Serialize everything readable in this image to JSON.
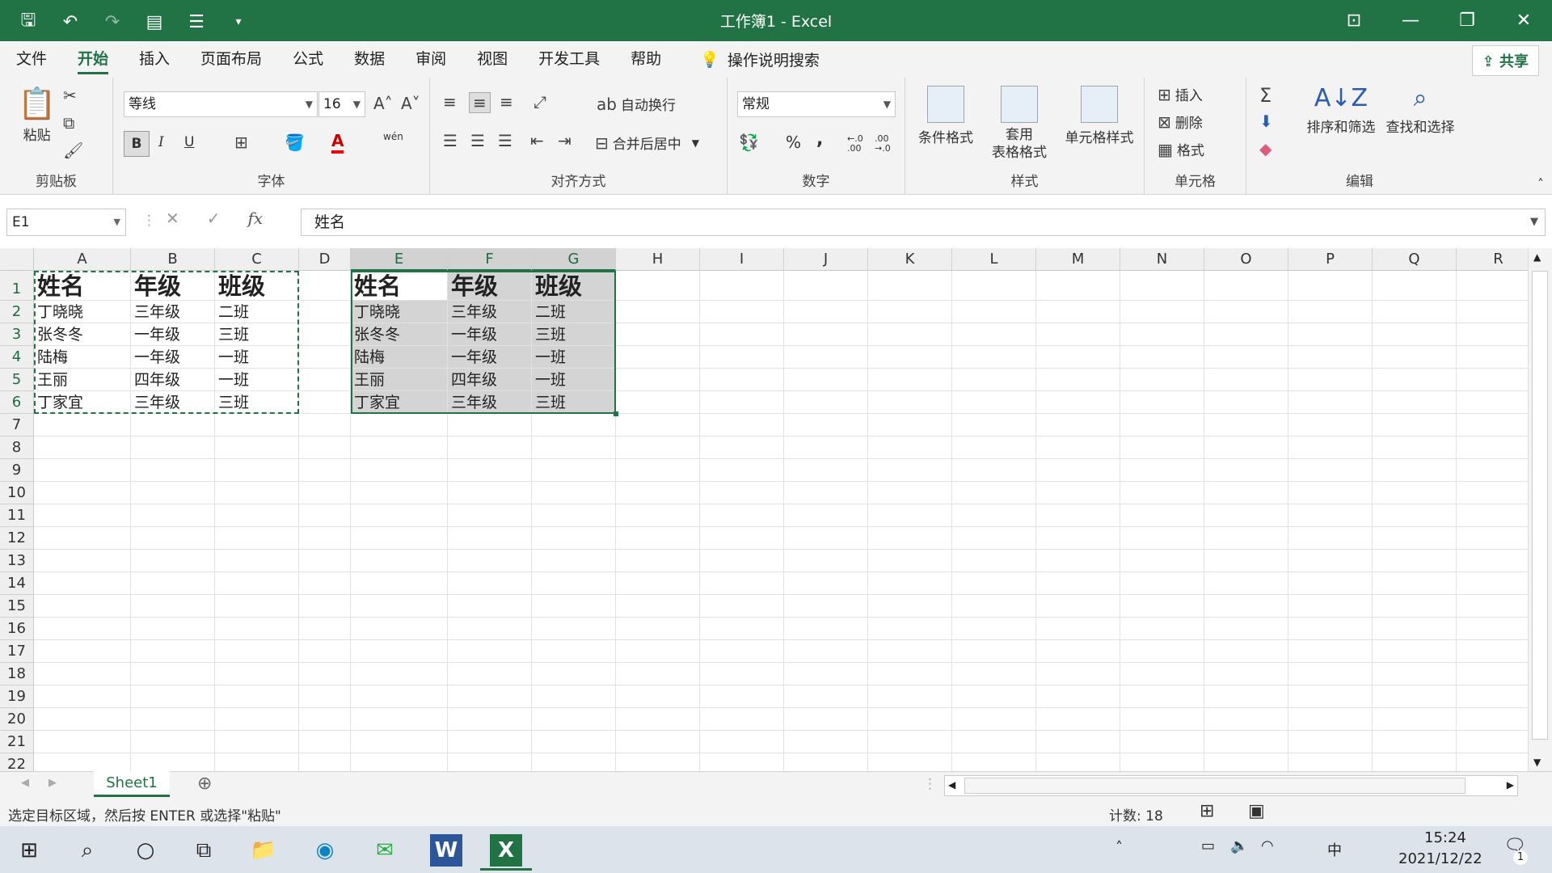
{
  "window": {
    "title": "工作簿1  -  Excel"
  },
  "menu": {
    "tabs": [
      "文件",
      "开始",
      "插入",
      "页面布局",
      "公式",
      "数据",
      "审阅",
      "视图",
      "开发工具",
      "帮助"
    ],
    "active": "开始",
    "search": "操作说明搜索",
    "share": "共享"
  },
  "ribbon": {
    "clipboard": {
      "label": "剪贴板",
      "paste": "粘贴"
    },
    "font": {
      "label": "字体",
      "name": "等线",
      "size": "16",
      "bold": "B",
      "italic": "I",
      "underline": "U",
      "phonetic": "wén"
    },
    "alignment": {
      "label": "对齐方式",
      "wrap": "自动换行",
      "merge": "合并后居中"
    },
    "number": {
      "label": "数字",
      "format": "常规",
      "percent": "%",
      "comma": ",",
      "inc_decimal": "←.0 .00",
      "dec_decimal": ".00 →.0"
    },
    "styles": {
      "label": "样式",
      "conditional": "条件格式",
      "table_format_line1": "套用",
      "table_format_line2": "表格格式",
      "cell_styles": "单元格样式"
    },
    "cells": {
      "label": "单元格",
      "insert": "插入",
      "delete": "删除",
      "format": "格式"
    },
    "editing": {
      "label": "编辑",
      "sort_filter": "排序和筛选",
      "find_select": "查找和选择"
    }
  },
  "formula_bar": {
    "name_box": "E1",
    "content": "姓名"
  },
  "grid": {
    "columns": [
      "A",
      "B",
      "C",
      "D",
      "E",
      "F",
      "G",
      "H",
      "I",
      "J",
      "K",
      "L",
      "M",
      "N",
      "O",
      "P",
      "Q",
      "R"
    ],
    "rows": [
      "1",
      "2",
      "3",
      "4",
      "5",
      "6",
      "7",
      "8",
      "9",
      "10",
      "11",
      "12",
      "13",
      "14",
      "15",
      "16",
      "17",
      "18",
      "19",
      "20",
      "21",
      "22"
    ],
    "source": [
      [
        "姓名",
        "年级",
        "班级"
      ],
      [
        "丁晓晓",
        "三年级",
        "二班"
      ],
      [
        "张冬冬",
        "一年级",
        "三班"
      ],
      [
        "陆梅",
        "一年级",
        "一班"
      ],
      [
        "王丽",
        "四年级",
        "一班"
      ],
      [
        "丁家宜",
        "三年级",
        "三班"
      ]
    ],
    "pasted": [
      [
        "姓名",
        "年级",
        "班级"
      ],
      [
        "丁晓晓",
        "三年级",
        "二班"
      ],
      [
        "张冬冬",
        "一年级",
        "三班"
      ],
      [
        "陆梅",
        "一年级",
        "一班"
      ],
      [
        "王丽",
        "四年级",
        "一班"
      ],
      [
        "丁家宜",
        "三年级",
        "三班"
      ]
    ]
  },
  "sheets": {
    "tab": "Sheet1"
  },
  "status": {
    "message": "选定目标区域，然后按 ENTER 或选择\"粘贴\"",
    "count": "计数: 18"
  },
  "taskbar": {
    "time": "15:24",
    "date": "2021/12/22",
    "ime": "中",
    "notifications": "1"
  }
}
